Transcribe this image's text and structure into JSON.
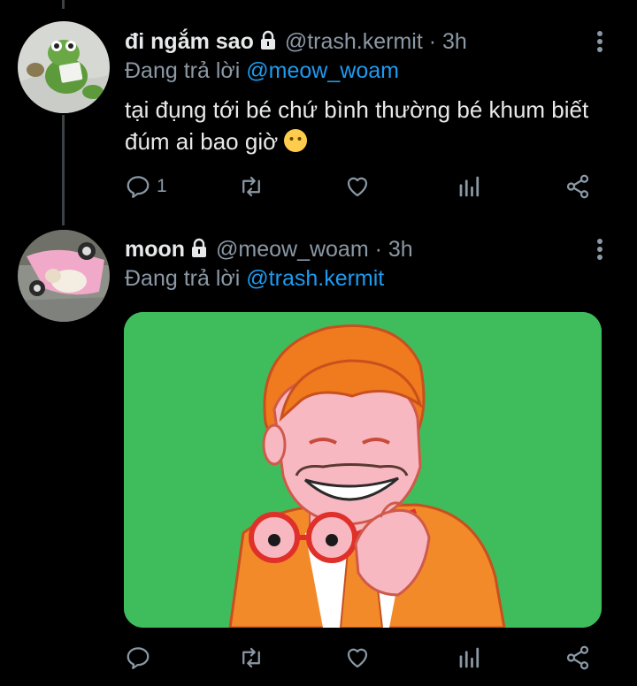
{
  "colors": {
    "background": "#000000",
    "accent": "#1d9bf0",
    "muted": "#8b98a5",
    "text": "#e7e9ea"
  },
  "tweets": [
    {
      "display_name": "đi ngắm sao",
      "handle_time": "@trash.kermit · 3h",
      "reply_prefix": "Đang trả lời",
      "reply_to": "@meow_woam",
      "text": "tại đụng tới bé chứ bình thường bé khum biết đúm ai bao giờ",
      "emoji": "neutral-face-emoji",
      "reply_count": "1",
      "icons": [
        "lock-icon",
        "more-icon",
        "reply-icon",
        "retweet-icon",
        "like-icon",
        "analytics-icon",
        "share-icon"
      ]
    },
    {
      "display_name": "moon",
      "handle_time": "@meow_woam · 3h",
      "reply_prefix": "Đang trả lời",
      "reply_to": "@trash.kermit",
      "reply_count": "",
      "media": "cartoon illustration of a smiling orange-haired man holding glasses on green background",
      "icons": [
        "lock-icon",
        "more-icon",
        "reply-icon",
        "retweet-icon",
        "like-icon",
        "analytics-icon",
        "share-icon"
      ]
    }
  ]
}
